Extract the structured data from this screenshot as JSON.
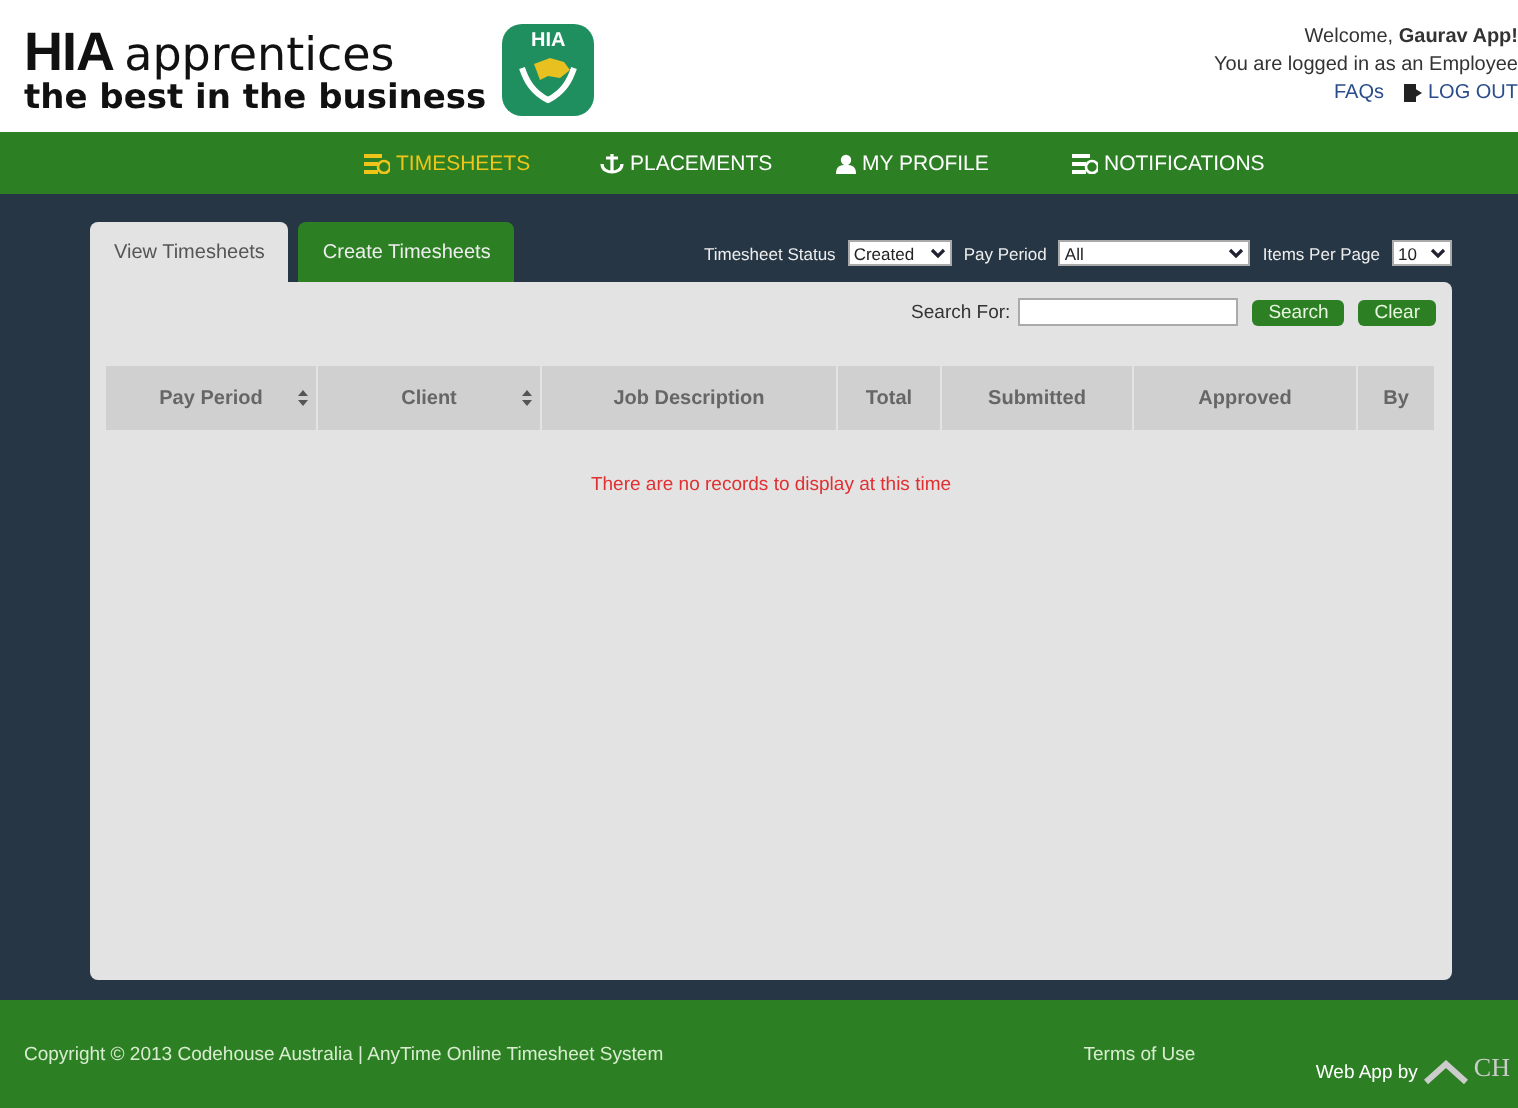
{
  "logo": {
    "brand": "HIA",
    "word": "apprentices",
    "tagline": "the best in the business",
    "badge": "HIA"
  },
  "user": {
    "welcome": "Welcome, **Gaurav App!**",
    "role": "You are logged in as an Employee",
    "faqs": "FAQs",
    "logout": "LOG OUT"
  },
  "nav": [
    {
      "label": "TIMESHEETS",
      "selected": true
    },
    {
      "label": "PLACEMENTS",
      "selected": false
    },
    {
      "label": "MY PROFILE",
      "selected": false
    },
    {
      "label": "NOTIFICATIONS",
      "selected": false
    }
  ],
  "tabs": [
    {
      "label": "View Timesheets",
      "selected": true
    },
    {
      "label": "Create Timesheets",
      "selected": false
    }
  ],
  "filters": [
    {
      "label": "Timesheet Status",
      "value": "Created"
    },
    {
      "label": "Pay Period",
      "value": "All"
    },
    {
      "label": "Items Per Page",
      "value": "10"
    }
  ],
  "search": {
    "label": "Search For:",
    "buttons": [
      "Search",
      "Clear"
    ]
  },
  "table": {
    "columns": [
      {
        "label": "Pay Period",
        "sortable": true
      },
      {
        "label": "Client",
        "sortable": true
      },
      {
        "label": "Job Description",
        "sortable": false
      },
      {
        "label": "Total",
        "sortable": false
      },
      {
        "label": "Submitted",
        "sortable": false
      },
      {
        "label": "Approved",
        "sortable": false
      },
      {
        "label": "By",
        "sortable": false
      }
    ],
    "empty": "There are no records to display at this time"
  },
  "footer": {
    "copyright": "Copyright © 2013 Codehouse Australia | AnyTime Online Timesheet System",
    "terms": "Terms of Use",
    "webapp": "Web App by",
    "maker": "CH"
  }
}
